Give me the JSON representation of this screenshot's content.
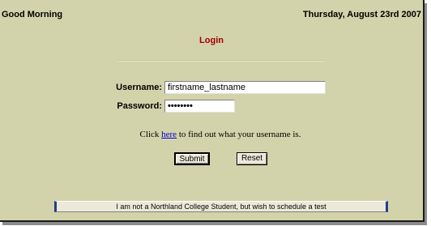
{
  "header": {
    "greeting": "Good Morning",
    "date": "Thursday, August 23rd 2007"
  },
  "login": {
    "title": "Login",
    "username_label": "Username:",
    "username_value": "firstname_lastname",
    "password_label": "Password:",
    "password_value": "••••••••"
  },
  "hint": {
    "prefix": "Click ",
    "link_text": "here",
    "suffix": " to find out what your username is."
  },
  "buttons": {
    "submit": "Submit",
    "reset": "Reset",
    "schedule": "I am not a Northland College Student, but wish to schedule a test"
  },
  "colors": {
    "background": "#d3d3ab",
    "title_red": "#a00000",
    "link_blue": "#0000cc"
  }
}
